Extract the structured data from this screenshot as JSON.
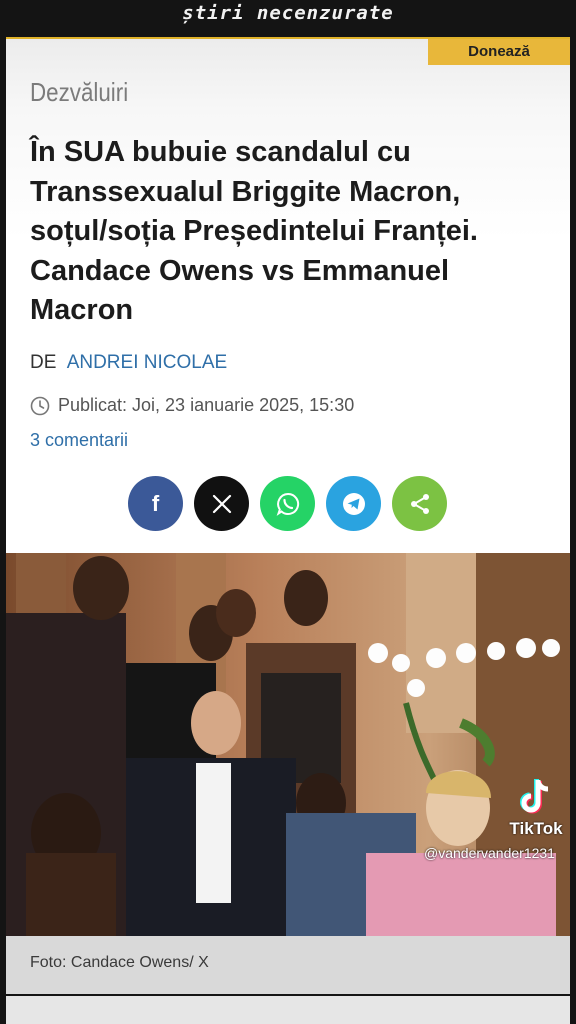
{
  "header": {
    "brand": "știri necenzurate"
  },
  "donate_label": "Donează",
  "article": {
    "category": "Dezvăluiri",
    "title": "În SUA bubuie scandalul cu Transsexualul Briggite Macron, soțul/soția Președintelui Franței. Candace Owens vs Emmanuel Macron",
    "byline_prefix": "DE",
    "author": "ANDREI NICOLAE",
    "published": "Publicat: Joi, 23 ianuarie 2025, 15:30",
    "comments": "3 comentarii",
    "photo_caption": "Foto: Candace Owens/ X"
  },
  "share_buttons": [
    {
      "network": "facebook",
      "icon": "f",
      "color": "#3b5998"
    },
    {
      "network": "x",
      "icon": "X",
      "color": "#111111"
    },
    {
      "network": "whatsapp",
      "icon": "whatsapp-icon",
      "color": "#25d366"
    },
    {
      "network": "telegram",
      "icon": "telegram-icon",
      "color": "#2aa3e0"
    },
    {
      "network": "share",
      "icon": "share-icon",
      "color": "#7cc243"
    }
  ],
  "overlay": {
    "tiktok_logo": "TikTok",
    "tiktok_handle": "@vandervander1231"
  }
}
